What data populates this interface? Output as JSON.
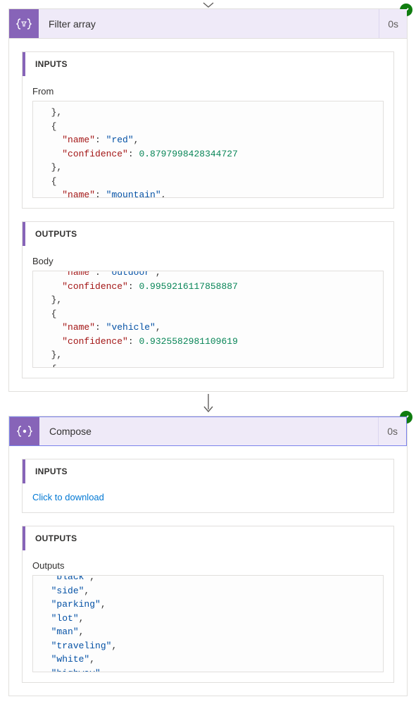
{
  "arrow_icon": "arrow-down",
  "cards": [
    {
      "icon": "filter-braces-icon",
      "title": "Filter array",
      "duration": "0s",
      "status": "success",
      "sections": {
        "inputs": {
          "header": "INPUTS",
          "field_label": "From",
          "json_lines": [
            {
              "indent": 1,
              "content": "},"
            },
            {
              "indent": 1,
              "content": "{"
            },
            {
              "indent": 2,
              "kv": true,
              "key": "name",
              "val_str": "red",
              "comma": true
            },
            {
              "indent": 2,
              "kv": true,
              "key": "confidence",
              "val_num": "0.8797998428344727"
            },
            {
              "indent": 1,
              "content": "},"
            },
            {
              "indent": 1,
              "content": "{"
            },
            {
              "indent": 2,
              "kv": true,
              "key": "name",
              "val_str": "mountain",
              "comma": true
            }
          ]
        },
        "outputs": {
          "header": "OUTPUTS",
          "field_label": "Body",
          "json_lines": [
            {
              "indent": 2,
              "kv": true,
              "key": "confidence",
              "val_num": "0.9959216117858887"
            },
            {
              "indent": 1,
              "content": "},"
            },
            {
              "indent": 1,
              "content": "{"
            },
            {
              "indent": 2,
              "kv": true,
              "key": "name",
              "val_str": "vehicle",
              "comma": true
            },
            {
              "indent": 2,
              "kv": true,
              "key": "confidence",
              "val_num": "0.9325582981109619"
            },
            {
              "indent": 1,
              "content": "},"
            },
            {
              "indent": 1,
              "content": "{"
            }
          ],
          "hidden_top": {
            "indent": 2,
            "kv": true,
            "key": "name",
            "val_str": "outdoor",
            "comma": true
          }
        }
      }
    },
    {
      "icon": "compose-braces-icon",
      "title": "Compose",
      "duration": "0s",
      "status": "success",
      "sections": {
        "inputs": {
          "header": "INPUTS",
          "link_text": "Click to download"
        },
        "outputs": {
          "header": "OUTPUTS",
          "field_label": "Outputs",
          "string_lines": [
            "side",
            "parking",
            "lot",
            "man",
            "traveling",
            "white",
            "highway"
          ],
          "hidden_top_str": "black"
        }
      }
    }
  ]
}
